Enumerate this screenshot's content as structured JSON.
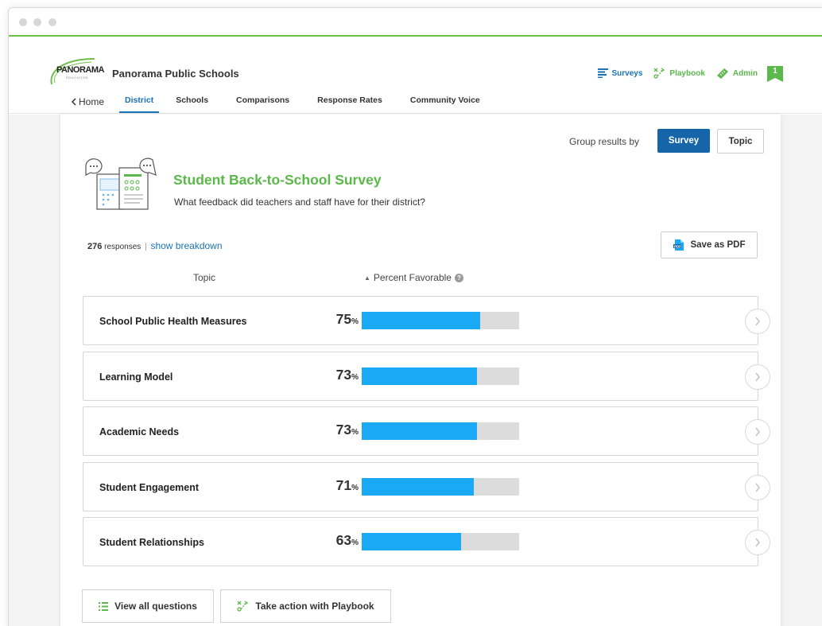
{
  "app": {
    "logo_text": "PANORAMA",
    "logo_subtext": "EDUCATION",
    "district_name": "Panorama Public Schools"
  },
  "top_nav": {
    "surveys": "Surveys",
    "playbook": "Playbook",
    "admin": "Admin",
    "flag_count": "1"
  },
  "sub_nav": {
    "home": "Home",
    "tabs": [
      {
        "label": "District",
        "active": true
      },
      {
        "label": "Schools",
        "active": false
      },
      {
        "label": "Comparisons",
        "active": false
      },
      {
        "label": "Response Rates",
        "active": false
      },
      {
        "label": "Community Voice",
        "active": false
      }
    ]
  },
  "grouping": {
    "label": "Group results by",
    "survey": "Survey",
    "topic": "Topic",
    "selected": "Survey"
  },
  "survey": {
    "title": "Student Back-to-School Survey",
    "subtitle": "What feedback did teachers and staff have for their district?",
    "responses_count": "276",
    "responses_label": "responses",
    "separator": "|",
    "breakdown_link": "show breakdown",
    "save_pdf": "Save as PDF"
  },
  "table": {
    "col_topic": "Topic",
    "col_percent": "Percent Favorable",
    "percent_sign": "%",
    "rows": [
      {
        "topic": "School Public Health Measures",
        "percent": 75
      },
      {
        "topic": "Learning Model",
        "percent": 73
      },
      {
        "topic": "Academic Needs",
        "percent": 73
      },
      {
        "topic": "Student Engagement",
        "percent": 71
      },
      {
        "topic": "Student Relationships",
        "percent": 63
      }
    ]
  },
  "actions": {
    "view_all": "View all questions",
    "take_action": "Take action with Playbook"
  },
  "colors": {
    "accent_blue": "#1565a8",
    "brand_green": "#5bb84a",
    "bar_fill": "#1aa9f5",
    "bar_track": "#dcdcdc"
  }
}
